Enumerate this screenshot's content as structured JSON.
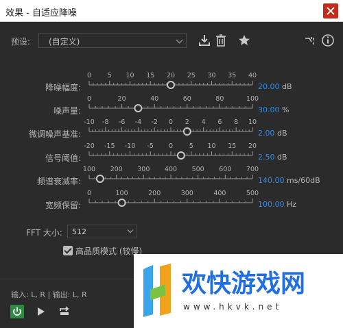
{
  "window": {
    "title": "效果 - 自适应降噪"
  },
  "preset": {
    "label": "预设:",
    "value": "(自定义)",
    "icons": [
      "download-preset-icon",
      "trash-icon",
      "star-icon",
      "routing-icon",
      "info-icon"
    ]
  },
  "params": [
    {
      "label": "降噪幅度:",
      "ticks": [
        "0",
        "5",
        "10",
        "15",
        "20",
        "25",
        "30",
        "35",
        "40"
      ],
      "min": 0,
      "max": 40,
      "value": 20,
      "value_text": "20.00",
      "unit": "dB"
    },
    {
      "label": "噪声量:",
      "ticks": [
        "0",
        "20",
        "40",
        "60",
        "80",
        "100"
      ],
      "min": 0,
      "max": 100,
      "value": 30,
      "value_text": "30.00",
      "unit": "%"
    },
    {
      "label": "微调噪声基准:",
      "ticks": [
        "-10",
        "-8",
        "-6",
        "-4",
        "-2",
        "0",
        "2",
        "4",
        "6",
        "8",
        "10"
      ],
      "min": -10,
      "max": 10,
      "value": 2,
      "value_text": "2.00",
      "unit": "dB"
    },
    {
      "label": "信号阈值:",
      "ticks": [
        "-20",
        "-15",
        "-10",
        "-5",
        "0",
        "5",
        "10",
        "15",
        "20"
      ],
      "min": -20,
      "max": 20,
      "value": 2.5,
      "value_text": "2.50",
      "unit": "dB"
    },
    {
      "label": "频谱衰减率:",
      "ticks": [
        "100",
        "200",
        "300",
        "400",
        "500",
        "600",
        "700"
      ],
      "min": 100,
      "max": 700,
      "value": 140,
      "value_text": "140.00",
      "unit": "ms/60dB"
    },
    {
      "label": "宽频保留:",
      "ticks": [
        "0",
        "100",
        "200",
        "300",
        "400",
        "500"
      ],
      "min": 0,
      "max": 500,
      "value": 100,
      "value_text": "100.00",
      "unit": "Hz"
    }
  ],
  "fft": {
    "label": "FFT 大小:",
    "value": "512"
  },
  "hq": {
    "label": "高品质模式 (较慢)",
    "checked": true
  },
  "io": {
    "text": "输入: L, R | 输出: L, R"
  },
  "watermark": {
    "text": "欢快游戏网",
    "url": "www.hkvk.net"
  },
  "colors": {
    "accent": "#2d8ceb",
    "power": "#2f8a43",
    "close": "#c42b1c"
  }
}
